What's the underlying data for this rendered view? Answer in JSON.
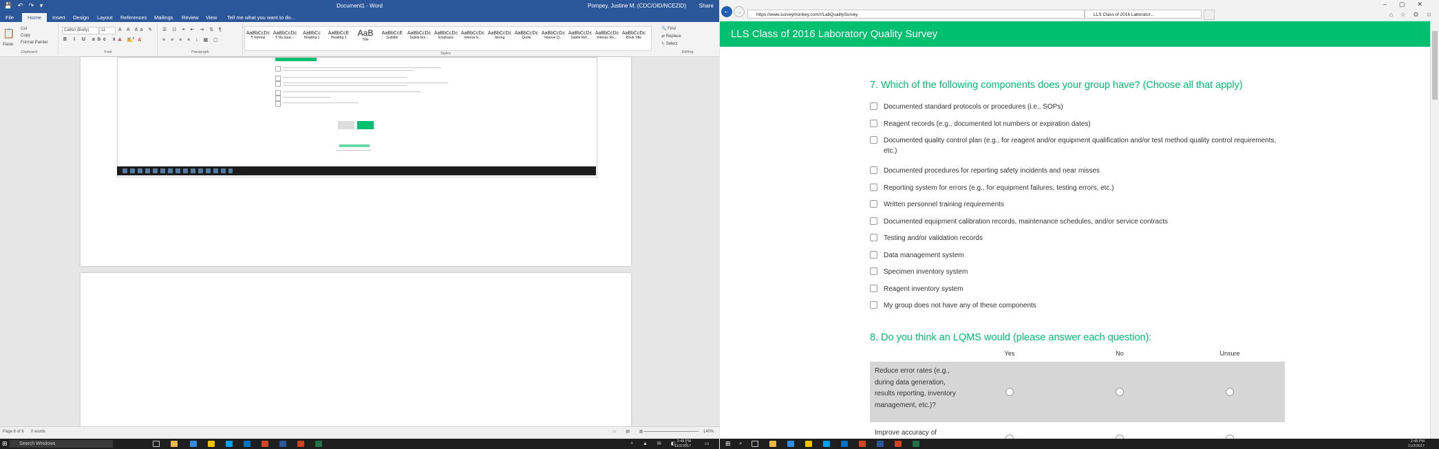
{
  "word": {
    "window_title": "Document1 - Word",
    "user": "Pompey, Justine M. (CDC/OID/NCEZID)",
    "share_label": "Share",
    "tabs": [
      "File",
      "Home",
      "Insert",
      "Design",
      "Layout",
      "References",
      "Mailings",
      "Review",
      "View"
    ],
    "tell_me": "Tell me what you want to do...",
    "ribbon": {
      "paste": "Paste",
      "cut": "Cut",
      "copy": "Copy",
      "format_painter": "Format Painter",
      "clipboard": "Clipboard",
      "font_name": "Calibri (Body)",
      "font_size": "11",
      "font": "Font",
      "paragraph": "Paragraph",
      "styles_label": "Styles",
      "find": "Find",
      "replace": "Replace",
      "select": "Select",
      "editing": "Editing",
      "styles": [
        {
          "preview": "AaBbCcDc",
          "name": "¶ Normal"
        },
        {
          "preview": "AaBbCcDc",
          "name": "¶ No Spac..."
        },
        {
          "preview": "AaBbCc",
          "name": "Heading 1"
        },
        {
          "preview": "AaBbCcE",
          "name": "Heading 2"
        },
        {
          "preview": "AaB",
          "name": "Title"
        },
        {
          "preview": "AaBbCcE",
          "name": "Subtitle"
        },
        {
          "preview": "AaBbCcDc",
          "name": "Subtle Em..."
        },
        {
          "preview": "AaBbCcDc",
          "name": "Emphasis"
        },
        {
          "preview": "AaBbCcDc",
          "name": "Intense E..."
        },
        {
          "preview": "AaBbCcDc",
          "name": "Strong"
        },
        {
          "preview": "AaBbCcDc",
          "name": "Quote"
        },
        {
          "preview": "AaBbCcDc",
          "name": "Intense Q..."
        },
        {
          "preview": "AaBbCcDc",
          "name": "Subtle Ref..."
        },
        {
          "preview": "AaBbCcDc",
          "name": "Intense Re..."
        },
        {
          "preview": "AaBbCcDc",
          "name": "Book Title"
        }
      ]
    },
    "status": {
      "page": "Page 6 of 6",
      "words": "0 words",
      "zoom": "140%"
    }
  },
  "ie": {
    "url": "https://www.surveymonkey.com/r/LabQualitySurvey",
    "tab_title": "LLS Class of 2016 Laborator...",
    "survey_title": "LLS Class of 2016 Laboratory Quality Survey",
    "q7": {
      "title": "7. Which of the following components does your group have? (Choose all that apply)",
      "options": [
        "Documented standard protocols or procedures (i.e., SOPs)",
        "Reagent records (e.g., documented lot numbers or expiration dates)",
        "Documented quality control plan (e.g., for reagent and/or equipment qualification and/or test method quality control requirements, etc.)",
        "Documented procedures for reporting safety incidents and near misses",
        "Reporting system for errors (e.g., for equipment failures, testing errors, etc.)",
        "Written personnel training requirements",
        "Documented equipment calibration records, maintenance schedules, and/or service contracts",
        "Testing and/or validation records",
        "Data management system",
        "Specimen inventory system",
        "Reagent inventory system",
        "My group does not have any of these components"
      ]
    },
    "q8": {
      "title": "8. Do you think an LQMS would (please answer each question):",
      "columns": [
        "Yes",
        "No",
        "Unsure"
      ],
      "rows": [
        "Reduce error rates (e.g., during data generation, results reporting, inventory management, etc.)?",
        "Improve accuracy of"
      ]
    }
  },
  "taskbar": {
    "search_placeholder": "Search Windows",
    "left_clock": {
      "time": "2:48 PM",
      "date": "11/2/2017"
    },
    "right_clock": {
      "time": "2:48 PM",
      "date": "11/2/2017"
    }
  }
}
